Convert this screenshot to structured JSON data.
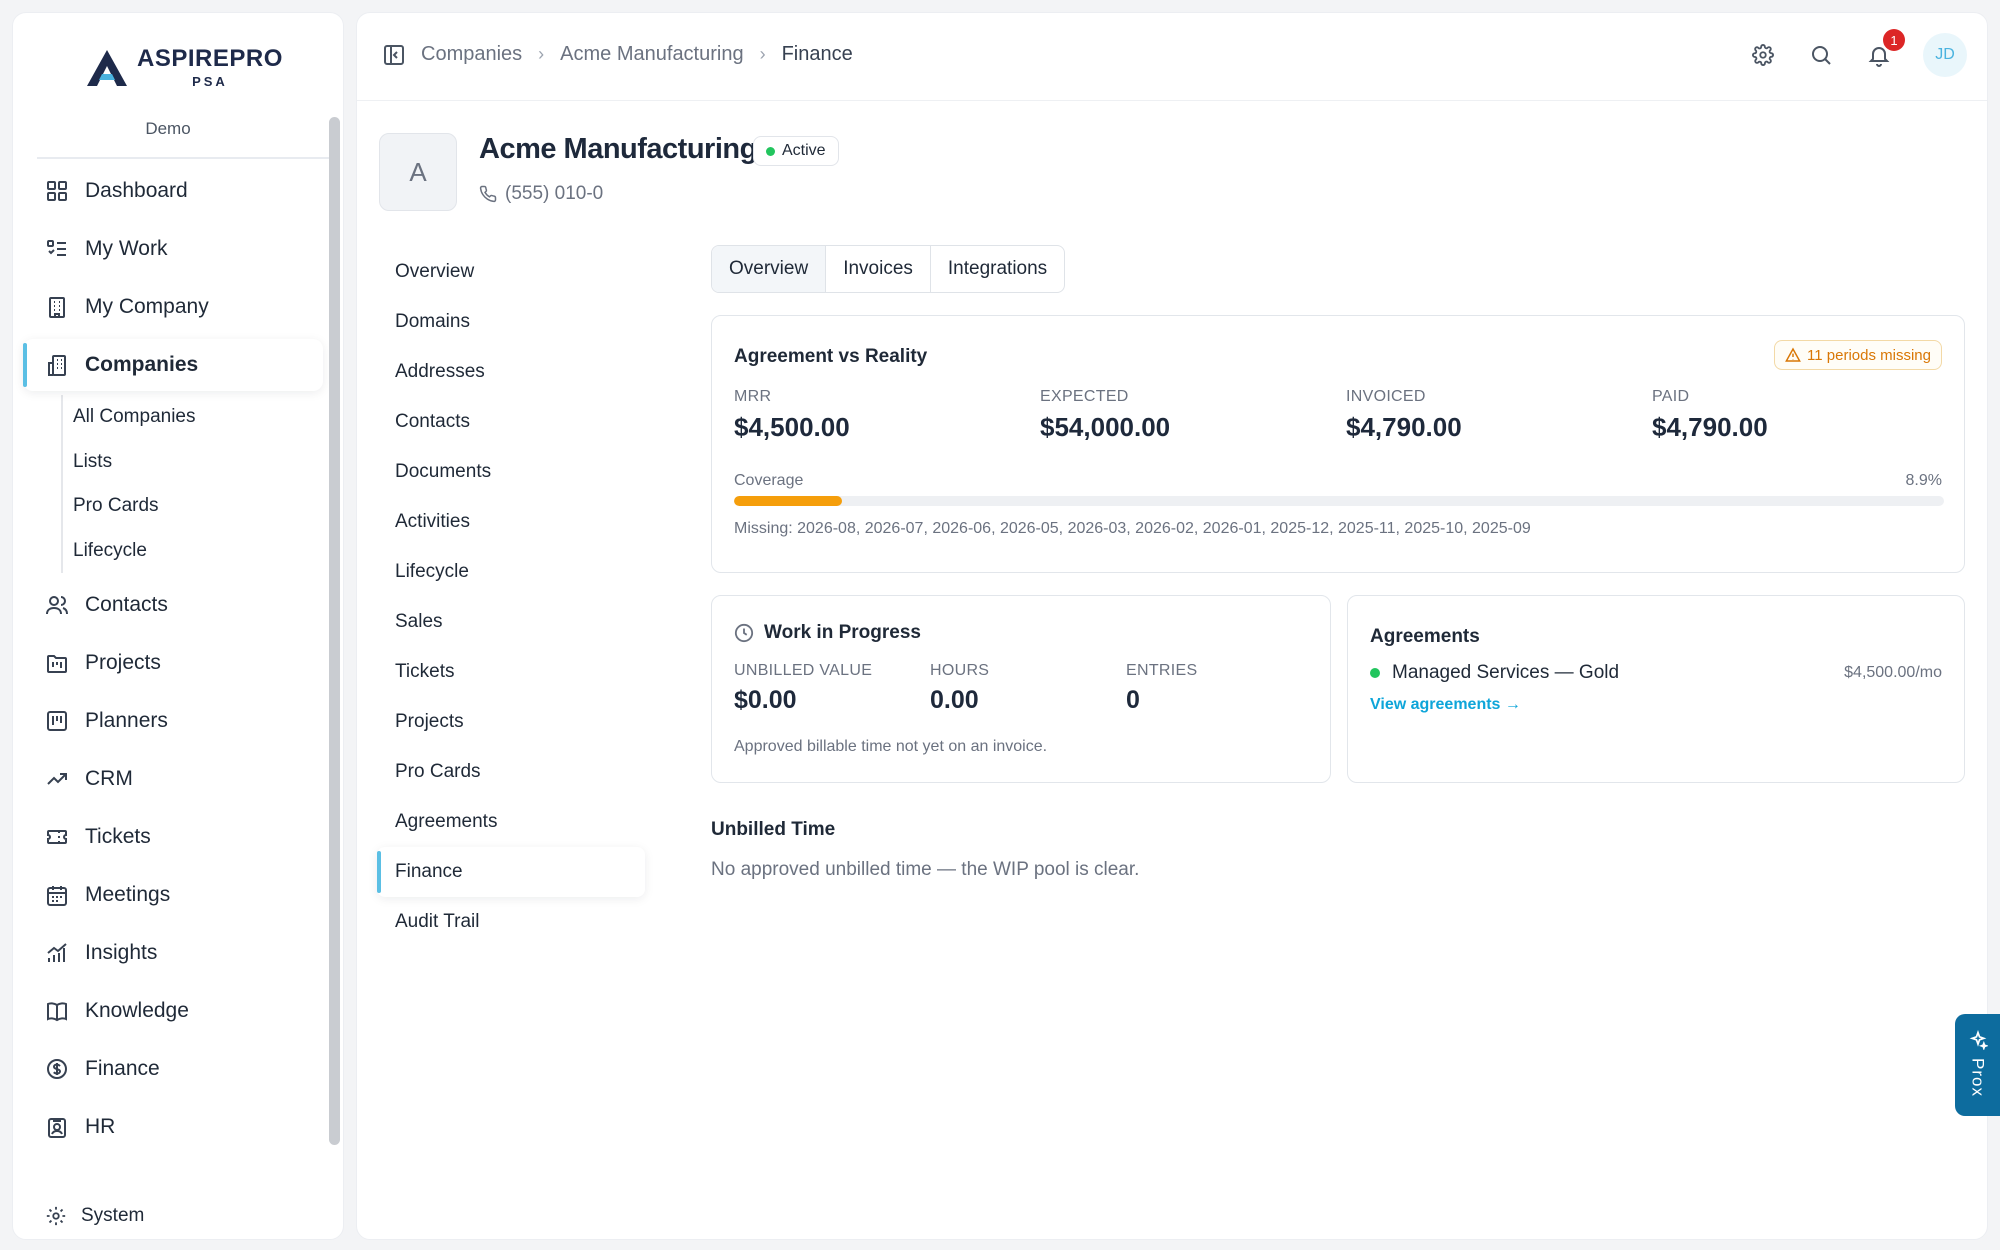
{
  "brand": {
    "name": "ASPIREPRO",
    "sub": "PSA",
    "tenant": "Demo"
  },
  "sidebar": {
    "items": [
      {
        "label": "Dashboard",
        "icon": "grid-icon"
      },
      {
        "label": "My Work",
        "icon": "list-check-icon"
      },
      {
        "label": "My Company",
        "icon": "building-icon"
      },
      {
        "label": "Companies",
        "icon": "buildings-icon",
        "active": true
      },
      {
        "label": "Contacts",
        "icon": "users-icon"
      },
      {
        "label": "Projects",
        "icon": "folder-kanban-icon"
      },
      {
        "label": "Planners",
        "icon": "kanban-icon"
      },
      {
        "label": "CRM",
        "icon": "trending-up-icon"
      },
      {
        "label": "Tickets",
        "icon": "ticket-icon"
      },
      {
        "label": "Meetings",
        "icon": "calendar-icon"
      },
      {
        "label": "Insights",
        "icon": "bar-chart-icon"
      },
      {
        "label": "Knowledge",
        "icon": "book-icon"
      },
      {
        "label": "Finance",
        "icon": "dollar-circle-icon"
      },
      {
        "label": "HR",
        "icon": "id-badge-icon"
      }
    ],
    "companies_sub": [
      "All Companies",
      "Lists",
      "Pro Cards",
      "Lifecycle"
    ],
    "system": "System"
  },
  "topbar": {
    "breadcrumbs": [
      "Companies",
      "Acme Manufacturing",
      "Finance"
    ],
    "notification_count": "1",
    "user_initials": "JD"
  },
  "company": {
    "initial": "A",
    "name": "Acme Manufacturing",
    "status": "Active",
    "phone": "(555) 010-0"
  },
  "section_nav": [
    "Overview",
    "Domains",
    "Addresses",
    "Contacts",
    "Documents",
    "Activities",
    "Lifecycle",
    "Sales",
    "Tickets",
    "Projects",
    "Pro Cards",
    "Agreements",
    "Finance",
    "Audit Trail"
  ],
  "section_nav_active": "Finance",
  "tabs": [
    "Overview",
    "Invoices",
    "Integrations"
  ],
  "tabs_active": "Overview",
  "agreement_vs_reality": {
    "title": "Agreement vs Reality",
    "warning": "11 periods missing",
    "metrics": [
      {
        "label": "MRR",
        "value": "$4,500.00"
      },
      {
        "label": "EXPECTED",
        "value": "$54,000.00"
      },
      {
        "label": "INVOICED",
        "value": "$4,790.00"
      },
      {
        "label": "PAID",
        "value": "$4,790.00"
      }
    ],
    "coverage_label": "Coverage",
    "coverage_value": "8.9%",
    "coverage_fraction": 0.089,
    "missing": "Missing: 2026-08, 2026-07, 2026-06, 2026-05, 2026-03, 2026-02, 2026-01, 2025-12, 2025-11, 2025-10, 2025-09"
  },
  "wip": {
    "title": "Work in Progress",
    "metrics": [
      {
        "label": "UNBILLED VALUE",
        "value": "$0.00"
      },
      {
        "label": "HOURS",
        "value": "0.00"
      },
      {
        "label": "ENTRIES",
        "value": "0"
      }
    ],
    "note": "Approved billable time not yet on an invoice."
  },
  "agreements": {
    "title": "Agreements",
    "items": [
      {
        "name": "Managed Services — Gold",
        "price": "$4,500.00/mo"
      }
    ],
    "link": "View agreements →"
  },
  "unbilled": {
    "title": "Unbilled Time",
    "text": "No approved unbilled time — the WIP pool is clear."
  },
  "assistant": {
    "label": "Prox"
  },
  "colors": {
    "accent": "#5bbfe4",
    "progress": "#f59e0b",
    "success": "#22c55e",
    "warning": "#d97706",
    "link": "#0ea5d9",
    "assistant": "#0d6c9e"
  }
}
